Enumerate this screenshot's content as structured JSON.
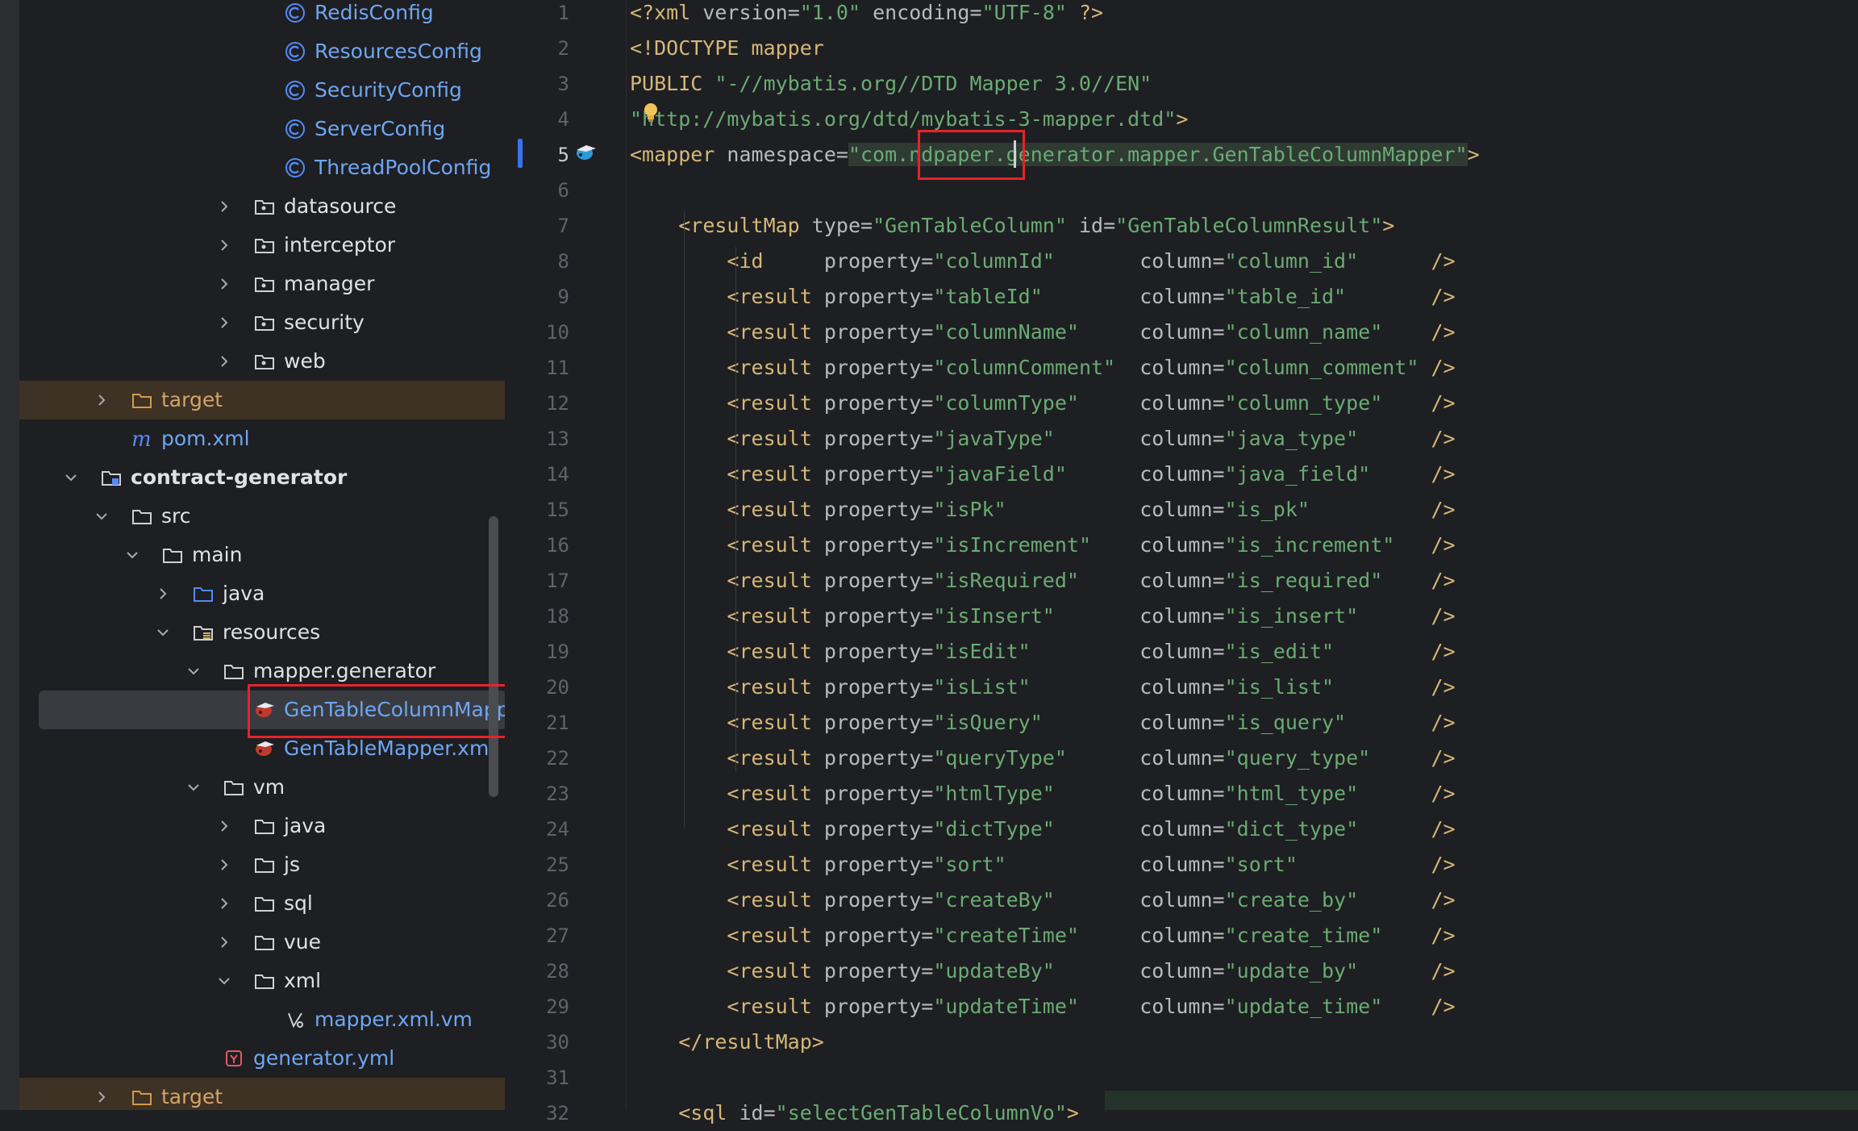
{
  "tree": [
    {
      "label": "RedisConfig",
      "icon": "class-icon",
      "indent": 354,
      "arrow": "none",
      "color": "blue"
    },
    {
      "label": "ResourcesConfig",
      "icon": "class-icon",
      "indent": 354,
      "arrow": "none",
      "color": "blue"
    },
    {
      "label": "SecurityConfig",
      "icon": "class-icon",
      "indent": 354,
      "arrow": "none",
      "color": "blue"
    },
    {
      "label": "ServerConfig",
      "icon": "class-icon",
      "indent": 354,
      "arrow": "none",
      "color": "blue"
    },
    {
      "label": "ThreadPoolConfig",
      "icon": "class-icon",
      "indent": 354,
      "arrow": "none",
      "color": "blue"
    },
    {
      "label": "datasource",
      "icon": "package-icon",
      "indent": 316,
      "arrow": "right",
      "color": "normal"
    },
    {
      "label": "interceptor",
      "icon": "package-icon",
      "indent": 316,
      "arrow": "right",
      "color": "normal"
    },
    {
      "label": "manager",
      "icon": "package-icon",
      "indent": 316,
      "arrow": "right",
      "color": "normal"
    },
    {
      "label": "security",
      "icon": "package-icon",
      "indent": 316,
      "arrow": "right",
      "color": "normal"
    },
    {
      "label": "web",
      "icon": "package-icon",
      "indent": 316,
      "arrow": "right",
      "color": "normal"
    },
    {
      "label": "target",
      "icon": "folder-orange-icon",
      "indent": 164,
      "arrow": "right",
      "color": "orange",
      "excluded": true
    },
    {
      "label": "pom.xml",
      "icon": "maven-icon",
      "indent": 164,
      "arrow": "none",
      "color": "blue"
    },
    {
      "label": "contract-generator",
      "icon": "module-icon",
      "indent": 126,
      "arrow": "down",
      "color": "normal",
      "bold": true
    },
    {
      "label": "src",
      "icon": "folder-icon",
      "indent": 164,
      "arrow": "down",
      "color": "normal"
    },
    {
      "label": "main",
      "icon": "folder-icon",
      "indent": 202,
      "arrow": "down",
      "color": "normal"
    },
    {
      "label": "java",
      "icon": "folder-blue-icon",
      "indent": 240,
      "arrow": "right",
      "color": "normal"
    },
    {
      "label": "resources",
      "icon": "resources-folder-icon",
      "indent": 240,
      "arrow": "down",
      "color": "normal"
    },
    {
      "label": "mapper.generator",
      "icon": "folder-icon",
      "indent": 278,
      "arrow": "down",
      "color": "normal"
    },
    {
      "label": "GenTableColumnMapper.xml",
      "icon": "mybatis-xml-icon",
      "indent": 316,
      "arrow": "none",
      "color": "blue",
      "selected": true
    },
    {
      "label": "GenTableMapper.xml",
      "icon": "mybatis-xml-icon",
      "indent": 316,
      "arrow": "none",
      "color": "blue"
    },
    {
      "label": "vm",
      "icon": "folder-icon",
      "indent": 278,
      "arrow": "down",
      "color": "normal"
    },
    {
      "label": "java",
      "icon": "folder-icon",
      "indent": 316,
      "arrow": "right",
      "color": "normal"
    },
    {
      "label": "js",
      "icon": "folder-icon",
      "indent": 316,
      "arrow": "right",
      "color": "normal"
    },
    {
      "label": "sql",
      "icon": "folder-icon",
      "indent": 316,
      "arrow": "right",
      "color": "normal"
    },
    {
      "label": "vue",
      "icon": "folder-icon",
      "indent": 316,
      "arrow": "right",
      "color": "normal"
    },
    {
      "label": "xml",
      "icon": "folder-icon",
      "indent": 316,
      "arrow": "down",
      "color": "normal"
    },
    {
      "label": "mapper.xml.vm",
      "icon": "velocity-icon",
      "indent": 354,
      "arrow": "none",
      "color": "blue"
    },
    {
      "label": "generator.yml",
      "icon": "yaml-icon",
      "indent": 278,
      "arrow": "none",
      "color": "blue"
    },
    {
      "label": "target",
      "icon": "folder-orange-icon",
      "indent": 164,
      "arrow": "right",
      "color": "orange",
      "excluded": true
    }
  ],
  "editor": {
    "current_line": 5,
    "code": [
      [
        "<?xml version=\"1.0\" encoding=\"UTF-8\" ?>"
      ],
      [
        "<!DOCTYPE mapper"
      ],
      [
        "PUBLIC \"-//mybatis.org//DTD Mapper 3.0//EN\""
      ],
      [
        "\"http://mybatis.org/dtd/mybatis-3-mapper.dtd\">"
      ],
      [
        "<mapper namespace=\"com.ndpaper.generator.mapper.GenTableColumnMapper\">"
      ],
      [
        ""
      ],
      [
        "    <resultMap type=\"GenTableColumn\" id=\"GenTableColumnResult\">"
      ],
      [
        "        <id     property=\"columnId\"       column=\"column_id\"      />"
      ],
      [
        "        <result property=\"tableId\"        column=\"table_id\"       />"
      ],
      [
        "        <result property=\"columnName\"     column=\"column_name\"    />"
      ],
      [
        "        <result property=\"columnComment\"  column=\"column_comment\" />"
      ],
      [
        "        <result property=\"columnType\"     column=\"column_type\"    />"
      ],
      [
        "        <result property=\"javaType\"       column=\"java_type\"      />"
      ],
      [
        "        <result property=\"javaField\"      column=\"java_field\"     />"
      ],
      [
        "        <result property=\"isPk\"           column=\"is_pk\"          />"
      ],
      [
        "        <result property=\"isIncrement\"    column=\"is_increment\"   />"
      ],
      [
        "        <result property=\"isRequired\"     column=\"is_required\"    />"
      ],
      [
        "        <result property=\"isInsert\"       column=\"is_insert\"      />"
      ],
      [
        "        <result property=\"isEdit\"         column=\"is_edit\"        />"
      ],
      [
        "        <result property=\"isList\"         column=\"is_list\"        />"
      ],
      [
        "        <result property=\"isQuery\"        column=\"is_query\"       />"
      ],
      [
        "        <result property=\"queryType\"      column=\"query_type\"     />"
      ],
      [
        "        <result property=\"htmlType\"       column=\"html_type\"      />"
      ],
      [
        "        <result property=\"dictType\"       column=\"dict_type\"      />"
      ],
      [
        "        <result property=\"sort\"           column=\"sort\"           />"
      ],
      [
        "        <result property=\"createBy\"       column=\"create_by\"      />"
      ],
      [
        "        <result property=\"createTime\"     column=\"create_time\"    />"
      ],
      [
        "        <result property=\"updateBy\"       column=\"update_by\"      />"
      ],
      [
        "        <result property=\"updateTime\"     column=\"update_time\"    />"
      ],
      [
        "    </resultMap>"
      ],
      [
        ""
      ],
      [
        "    <sql id=\"selectGenTableColumnVo\">"
      ]
    ]
  },
  "colors": {
    "tag": "#d5b778",
    "attribute": "#bababa",
    "string": "#6aab73",
    "highlight_box": "#e5242a",
    "selection": "#393b40",
    "excluded": "#3d3223"
  }
}
